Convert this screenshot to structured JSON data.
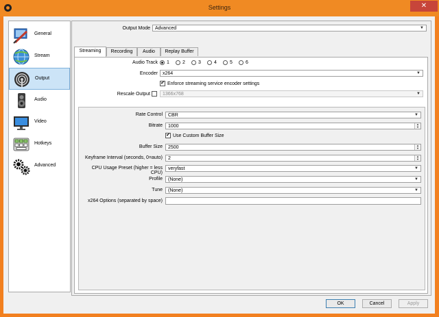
{
  "window": {
    "title": "Settings",
    "close_glyph": "✕"
  },
  "sidebar": {
    "items": [
      {
        "label": "General",
        "icon": "general-icon"
      },
      {
        "label": "Stream",
        "icon": "stream-icon"
      },
      {
        "label": "Output",
        "icon": "output-icon",
        "selected": true
      },
      {
        "label": "Audio",
        "icon": "audio-icon"
      },
      {
        "label": "Video",
        "icon": "video-icon"
      },
      {
        "label": "Hotkeys",
        "icon": "hotkeys-icon"
      },
      {
        "label": "Advanced",
        "icon": "advanced-icon"
      }
    ]
  },
  "output_mode": {
    "label": "Output Mode",
    "value": "Advanced"
  },
  "tabs": [
    {
      "label": "Streaming",
      "active": true
    },
    {
      "label": "Recording"
    },
    {
      "label": "Audio"
    },
    {
      "label": "Replay Buffer"
    }
  ],
  "streaming": {
    "audio_track": {
      "label": "Audio Track",
      "options": [
        "1",
        "2",
        "3",
        "4",
        "5",
        "6"
      ],
      "selected": "1"
    },
    "encoder": {
      "label": "Encoder",
      "value": "x264"
    },
    "enforce": {
      "label": "Enforce streaming service encoder settings",
      "checked": true
    },
    "rescale": {
      "label": "Rescale Output",
      "checked": false,
      "value": "1366x768"
    },
    "rate_control": {
      "label": "Rate Control",
      "value": "CBR"
    },
    "bitrate": {
      "label": "Bitrate",
      "value": "1000"
    },
    "custom_buffer": {
      "label": "Use Custom Buffer Size",
      "checked": true
    },
    "buffer_size": {
      "label": "Buffer Size",
      "value": "2500"
    },
    "keyframe": {
      "label": "Keyframe Interval (seconds, 0=auto)",
      "value": "2"
    },
    "cpu_preset": {
      "label": "CPU Usage Preset (higher = less CPU)",
      "value": "veryfast"
    },
    "profile": {
      "label": "Profile",
      "value": "(None)"
    },
    "tune": {
      "label": "Tune",
      "value": "(None)"
    },
    "x264_options": {
      "label": "x264 Options (separated by space)",
      "value": ""
    }
  },
  "buttons": {
    "ok": "OK",
    "cancel": "Cancel",
    "apply": "Apply"
  },
  "colors": {
    "accent": "#f08a23",
    "selection": "#cce4f7"
  }
}
